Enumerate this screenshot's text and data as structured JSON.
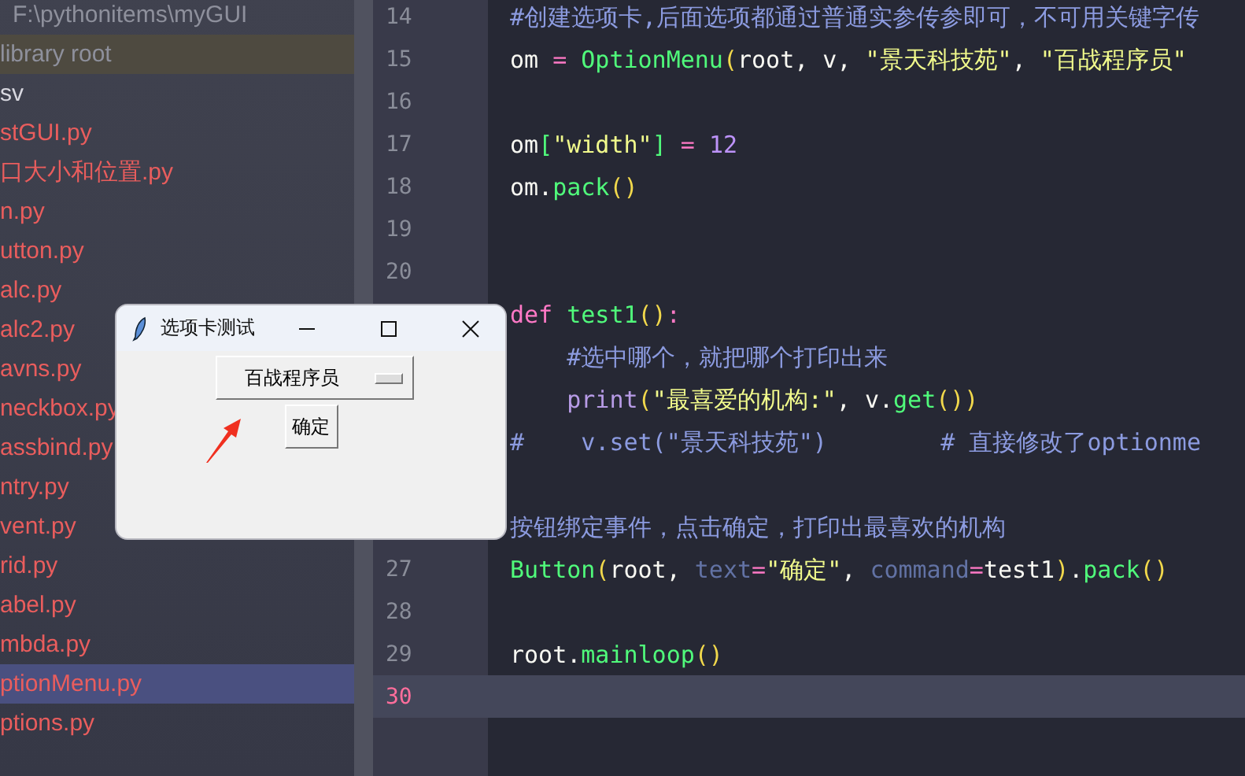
{
  "project_tree": {
    "items": [
      {
        "label": "F:\\pythonitems\\myGUI",
        "kind": "path",
        "selected": false
      },
      {
        "label": "library root",
        "kind": "root",
        "selected": false
      },
      {
        "label": "sv",
        "kind": "plain",
        "selected": false
      },
      {
        "label": "stGUI.py",
        "kind": "error",
        "selected": false
      },
      {
        "label": "口大小和位置.py",
        "kind": "error",
        "selected": false
      },
      {
        "label": "n.py",
        "kind": "error",
        "selected": false
      },
      {
        "label": "utton.py",
        "kind": "error",
        "selected": false
      },
      {
        "label": "alc.py",
        "kind": "error",
        "selected": false
      },
      {
        "label": "alc2.py",
        "kind": "error",
        "selected": false
      },
      {
        "label": "avns.py",
        "kind": "error",
        "selected": false
      },
      {
        "label": "neckbox.py",
        "kind": "error",
        "selected": false
      },
      {
        "label": "assbind.py",
        "kind": "error",
        "selected": false
      },
      {
        "label": "ntry.py",
        "kind": "error",
        "selected": false
      },
      {
        "label": "vent.py",
        "kind": "error",
        "selected": false
      },
      {
        "label": "rid.py",
        "kind": "error",
        "selected": false
      },
      {
        "label": "abel.py",
        "kind": "error",
        "selected": false
      },
      {
        "label": "mbda.py",
        "kind": "error",
        "selected": false
      },
      {
        "label": "ptionMenu.py",
        "kind": "error",
        "selected": true
      },
      {
        "label": "ptions.py",
        "kind": "error",
        "selected": false
      }
    ]
  },
  "editor": {
    "lines": [
      {
        "number": "14",
        "current": false,
        "tokens": [
          {
            "text": "#创建选项卡,后面选项都通过普通实参传参即可，不可用关键字传",
            "kind": "comment"
          }
        ]
      },
      {
        "number": "15",
        "current": false,
        "tokens": [
          {
            "text": "om ",
            "kind": "plain"
          },
          {
            "text": "= ",
            "kind": "op"
          },
          {
            "text": "OptionMenu",
            "kind": "func"
          },
          {
            "text": "(",
            "kind": "paren"
          },
          {
            "text": "root, v, ",
            "kind": "plain"
          },
          {
            "text": "\"景天科技苑\"",
            "kind": "string"
          },
          {
            "text": ", ",
            "kind": "plain"
          },
          {
            "text": "\"百战程序员\"",
            "kind": "string"
          }
        ]
      },
      {
        "number": "16",
        "current": false
      },
      {
        "number": "17",
        "current": false,
        "tokens": [
          {
            "text": "om",
            "kind": "plain"
          },
          {
            "text": "[",
            "kind": "func"
          },
          {
            "text": "\"width\"",
            "kind": "string"
          },
          {
            "text": "]",
            "kind": "func"
          },
          {
            "text": " = ",
            "kind": "op"
          },
          {
            "text": "12",
            "kind": "num"
          }
        ]
      },
      {
        "number": "18",
        "current": false,
        "tokens": [
          {
            "text": "om.",
            "kind": "plain"
          },
          {
            "text": "pack",
            "kind": "func"
          },
          {
            "text": "()",
            "kind": "paren"
          }
        ]
      },
      {
        "number": "19",
        "current": false
      },
      {
        "number": "20",
        "current": false
      },
      {
        "current": false,
        "tokens": [
          {
            "text": "def ",
            "kind": "kw"
          },
          {
            "text": "test1",
            "kind": "func"
          },
          {
            "text": "()",
            "kind": "paren"
          },
          {
            "text": ":",
            "kind": "op"
          }
        ]
      },
      {
        "current": false,
        "tokens": [
          {
            "text": "    #选中哪个，就把哪个打印出来",
            "kind": "comment"
          }
        ]
      },
      {
        "current": false,
        "tokens": [
          {
            "text": "    print",
            "kind": "builtin"
          },
          {
            "text": "(",
            "kind": "paren"
          },
          {
            "text": "\"最喜爱的机构:\"",
            "kind": "string"
          },
          {
            "text": ", v.",
            "kind": "plain"
          },
          {
            "text": "get",
            "kind": "func"
          },
          {
            "text": "())",
            "kind": "paren"
          }
        ]
      },
      {
        "current": false,
        "tokens": [
          {
            "text": "#    v.set(\"景天科技苑\")        # 直接修改了optionme",
            "kind": "comment"
          }
        ]
      },
      {
        "current": false
      },
      {
        "current": false,
        "tokens": [
          {
            "text": "按钮绑定事件，点击确定，打印出最喜欢的机构",
            "kind": "comment"
          }
        ]
      },
      {
        "number": "27",
        "current": false,
        "tokens": [
          {
            "text": "Button",
            "kind": "func"
          },
          {
            "text": "(",
            "kind": "paren"
          },
          {
            "text": "root, ",
            "kind": "plain"
          },
          {
            "text": "text",
            "kind": "param"
          },
          {
            "text": "=",
            "kind": "op"
          },
          {
            "text": "\"确定\"",
            "kind": "string"
          },
          {
            "text": ", ",
            "kind": "plain"
          },
          {
            "text": "command",
            "kind": "param"
          },
          {
            "text": "=",
            "kind": "op"
          },
          {
            "text": "test1",
            "kind": "plain"
          },
          {
            "text": ")",
            "kind": "paren"
          },
          {
            "text": ".",
            "kind": "plain"
          },
          {
            "text": "pack",
            "kind": "func"
          },
          {
            "text": "()",
            "kind": "paren"
          }
        ]
      },
      {
        "number": "28",
        "current": false
      },
      {
        "number": "29",
        "current": false,
        "tokens": [
          {
            "text": "root.",
            "kind": "plain"
          },
          {
            "text": "mainloop",
            "kind": "func"
          },
          {
            "text": "()",
            "kind": "paren"
          }
        ]
      },
      {
        "number": "30",
        "current": true
      }
    ]
  },
  "tk_window": {
    "title": "选项卡测试",
    "option_menu": {
      "value": "百战程序员"
    },
    "button": "确定"
  }
}
